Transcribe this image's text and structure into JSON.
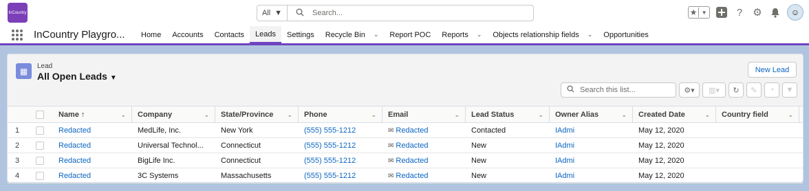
{
  "header": {
    "logo_text": "InCountry",
    "search_scope": "All",
    "search_placeholder": "Search..."
  },
  "nav": {
    "app_name": "InCountry Playgro...",
    "items": [
      {
        "label": "Home",
        "dropdown": false,
        "active": false
      },
      {
        "label": "Accounts",
        "dropdown": false,
        "active": false
      },
      {
        "label": "Contacts",
        "dropdown": false,
        "active": false
      },
      {
        "label": "Leads",
        "dropdown": false,
        "active": true
      },
      {
        "label": "Settings",
        "dropdown": false,
        "active": false
      },
      {
        "label": "Recycle Bin",
        "dropdown": true,
        "active": false
      },
      {
        "label": "Report POC",
        "dropdown": false,
        "active": false
      },
      {
        "label": "Reports",
        "dropdown": true,
        "active": false
      },
      {
        "label": "Objects relationship fields",
        "dropdown": true,
        "active": false
      },
      {
        "label": "Opportunities",
        "dropdown": false,
        "active": false
      }
    ]
  },
  "list": {
    "object_label": "Lead",
    "view_title": "All Open Leads",
    "new_button": "New Lead",
    "search_placeholder": "Search this list..."
  },
  "table": {
    "columns": [
      "Name ↑",
      "Company",
      "State/Province",
      "Phone",
      "Email",
      "Lead Status",
      "Owner Alias",
      "Created Date",
      "Country field"
    ],
    "rows": [
      {
        "num": "1",
        "name": "Redacted",
        "company": "MedLife, Inc.",
        "state": "New York",
        "phone": "(555) 555-1212",
        "email": "Redacted",
        "status": "Contacted",
        "owner": "IAdmi",
        "created": "May 12, 2020",
        "country": ""
      },
      {
        "num": "2",
        "name": "Redacted",
        "company": "Universal Technol...",
        "state": "Connecticut",
        "phone": "(555) 555-1212",
        "email": "Redacted",
        "status": "New",
        "owner": "IAdmi",
        "created": "May 12, 2020",
        "country": ""
      },
      {
        "num": "3",
        "name": "Redacted",
        "company": "BigLife Inc.",
        "state": "Connecticut",
        "phone": "(555) 555-1212",
        "email": "Redacted",
        "status": "New",
        "owner": "IAdmi",
        "created": "May 12, 2020",
        "country": ""
      },
      {
        "num": "4",
        "name": "Redacted",
        "company": "3C Systems",
        "state": "Massachusetts",
        "phone": "(555) 555-1212",
        "email": "Redacted",
        "status": "New",
        "owner": "IAdmi",
        "created": "May 12, 2020",
        "country": ""
      }
    ]
  },
  "colors": {
    "accent": "#6f42c1",
    "link": "#0b65c1",
    "background": "#b0c4df"
  }
}
